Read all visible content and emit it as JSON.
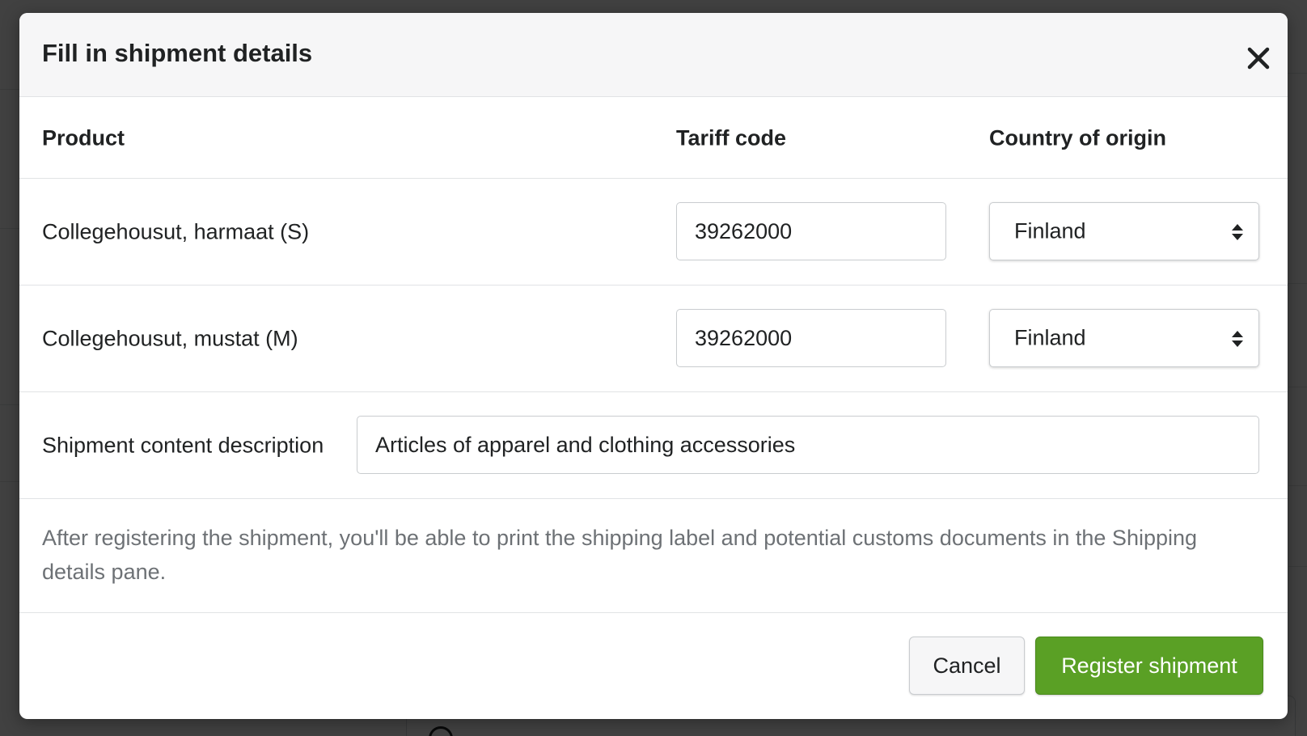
{
  "modal": {
    "title": "Fill in shipment details",
    "columns": {
      "product": "Product",
      "tariff_code": "Tariff code",
      "country_of_origin": "Country of origin"
    },
    "rows": [
      {
        "product": "Collegehousut, harmaat (S)",
        "tariff_code": "39262000",
        "country": "Finland"
      },
      {
        "product": "Collegehousut, mustat (M)",
        "tariff_code": "39262000",
        "country": "Finland"
      }
    ],
    "description_label": "Shipment content description",
    "description_value": "Articles of apparel and clothing accessories",
    "info_text": "After registering the shipment, you'll be able to print the shipping label and potential customs documents in the Shipping details pane.",
    "cancel_label": "Cancel",
    "register_label": "Register shipment"
  },
  "colors": {
    "primary": "#5aa025",
    "overlay": "#3c3c3c",
    "link": "#2c6ecb"
  },
  "icons": {
    "close": "close-icon",
    "select_arrows": "select-arrows-icon"
  }
}
